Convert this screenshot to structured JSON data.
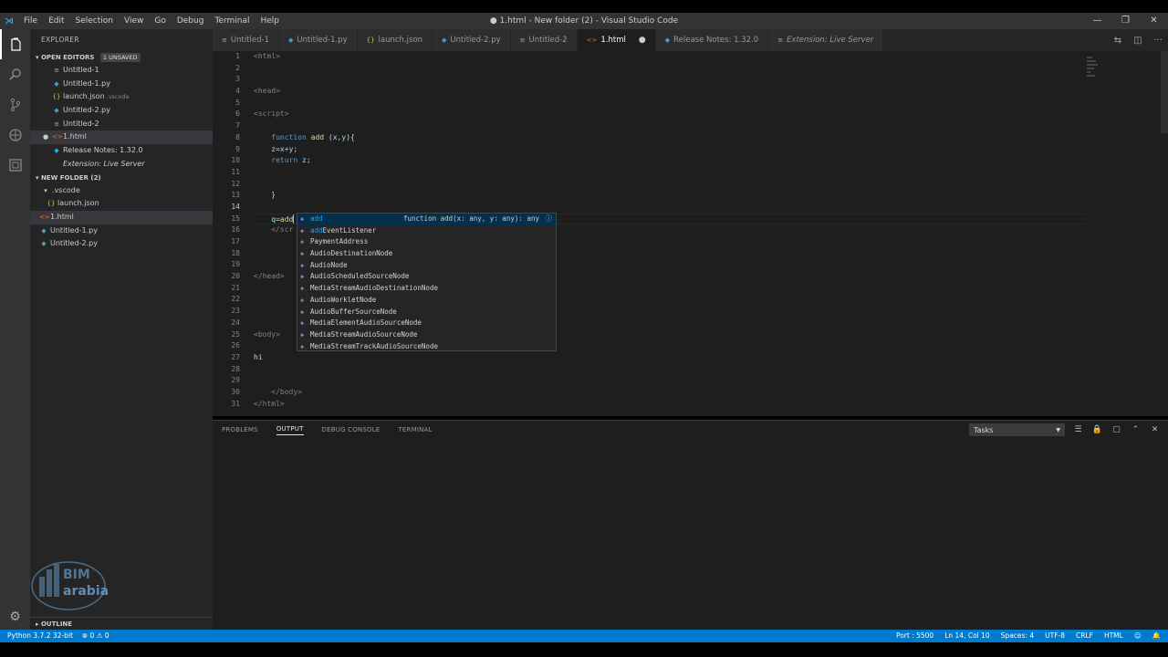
{
  "window": {
    "title": "● 1.html - New folder (2) - Visual Studio Code",
    "menu": [
      "File",
      "Edit",
      "Selection",
      "View",
      "Go",
      "Debug",
      "Terminal",
      "Help"
    ],
    "controls": [
      "—",
      "❐",
      "✕"
    ]
  },
  "explorer": {
    "title": "EXPLORER",
    "open_editors": {
      "label": "OPEN EDITORS",
      "badge": "1 UNSAVED",
      "items": [
        {
          "icon": "text-file-icon",
          "label": "Untitled-1",
          "hint": ""
        },
        {
          "icon": "python-icon",
          "label": "Untitled-1.py",
          "hint": ""
        },
        {
          "icon": "json-icon",
          "label": "launch.json",
          "hint": ".vscode"
        },
        {
          "icon": "python-icon",
          "label": "Untitled-2.py",
          "hint": ""
        },
        {
          "icon": "text-file-icon",
          "label": "Untitled-2",
          "hint": ""
        },
        {
          "icon": "html-icon",
          "label": "1.html",
          "hint": ""
        },
        {
          "icon": "vscode-icon",
          "label": "Release Notes: 1.32.0",
          "hint": ""
        },
        {
          "icon": "extension-icon",
          "label": "Extension: Live Server",
          "hint": ""
        }
      ]
    },
    "folder": {
      "label": "NEW FOLDER (2)",
      "items": [
        {
          "icon": "folder-icon",
          "label": ".vscode"
        },
        {
          "icon": "json-icon",
          "label": "launch.json"
        },
        {
          "icon": "html-icon",
          "label": "1.html"
        },
        {
          "icon": "python-icon",
          "label": "Untitled-1.py"
        },
        {
          "icon": "python-icon",
          "label": "Untitled-2.py"
        }
      ]
    },
    "outline": "OUTLINE",
    "watermark": "BIM arabia"
  },
  "tabs": [
    {
      "label": "Untitled-1",
      "icon": "≡"
    },
    {
      "label": "Untitled-1.py",
      "icon": "◆"
    },
    {
      "label": "launch.json",
      "icon": "{}"
    },
    {
      "label": "Untitled-2.py",
      "icon": "◆"
    },
    {
      "label": "Untitled-2",
      "icon": "≡"
    },
    {
      "label": "1.html",
      "icon": "<>"
    },
    {
      "label": "Release Notes: 1.32.0",
      "icon": "◆"
    },
    {
      "label": "Extension: Live Server",
      "icon": "≡"
    }
  ],
  "editor": {
    "lines": [
      "<html>",
      "",
      "",
      "<head>",
      "",
      "<script>",
      "",
      "    function add (x,y){",
      "    z=x+y;",
      "    return z;",
      "",
      "",
      "    }",
      "",
      "    q=add",
      "    </scr",
      "",
      "",
      "",
      "</head>",
      "",
      "",
      "",
      "",
      "<body>",
      "",
      "hi",
      "",
      "",
      "    </body>",
      "</html>"
    ],
    "line_numbers": [
      "1",
      "2",
      "3",
      "4",
      "5",
      "6",
      "7",
      "8",
      "9",
      "10",
      "11",
      "12",
      "13",
      "14",
      "15",
      "16",
      "17",
      "18",
      "19",
      "20",
      "21",
      "22",
      "23",
      "24",
      "25",
      "26",
      "27",
      "28",
      "29",
      "30",
      "31"
    ]
  },
  "suggestions": [
    {
      "match": "add",
      "rest": "",
      "detail": "function add(x: any, y: any): any",
      "info": "ⓘ"
    },
    {
      "match": "add",
      "rest": "EventListener"
    },
    {
      "match": "",
      "rest": "PaymentAddress"
    },
    {
      "match": "",
      "rest": "AudioDestinationNode"
    },
    {
      "match": "",
      "rest": "AudioNode"
    },
    {
      "match": "",
      "rest": "AudioScheduledSourceNode"
    },
    {
      "match": "",
      "rest": "MediaStreamAudioDestinationNode"
    },
    {
      "match": "",
      "rest": "AudioWorkletNode"
    },
    {
      "match": "",
      "rest": "AudioBufferSourceNode"
    },
    {
      "match": "",
      "rest": "MediaElementAudioSourceNode"
    },
    {
      "match": "",
      "rest": "MediaStreamAudioSourceNode"
    },
    {
      "match": "",
      "rest": "MediaStreamTrackAudioSourceNode"
    }
  ],
  "panel": {
    "tabs": [
      "PROBLEMS",
      "OUTPUT",
      "DEBUG CONSOLE",
      "TERMINAL"
    ],
    "select": "Tasks"
  },
  "status": {
    "python": "Python 3.7.2 32-bit",
    "problems": "⊗ 0 ⚠ 0",
    "port": "Port : 5500",
    "position": "Ln 14, Col 10",
    "spaces": "Spaces: 4",
    "encoding": "UTF-8",
    "eol": "CRLF",
    "language": "HTML"
  }
}
